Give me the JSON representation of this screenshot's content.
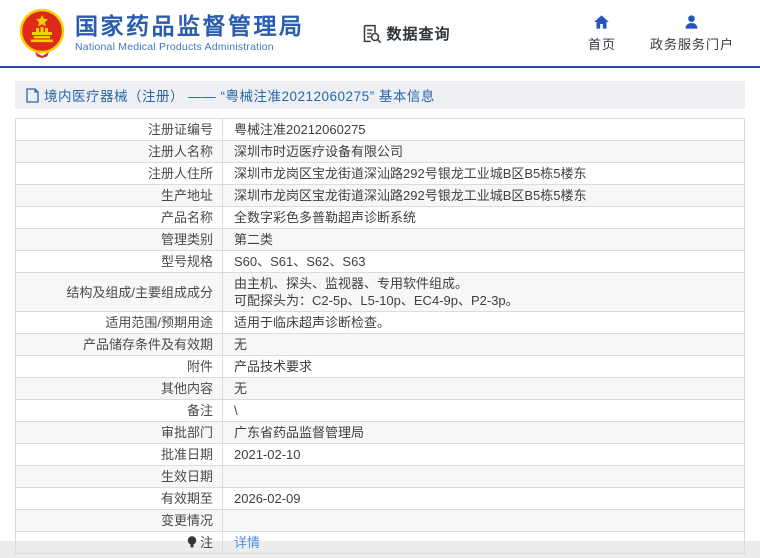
{
  "header": {
    "org_name_cn": "国家药品监督管理局",
    "org_name_en": "National Medical Products Administration",
    "data_query_label": "数据查询",
    "nav": [
      {
        "label": "首页",
        "icon": "home-icon"
      },
      {
        "label": "政务服务门户",
        "icon": "user-icon"
      }
    ]
  },
  "breadcrumb": {
    "text": "境内医疗器械（注册） —— “粤械注准20212060275” 基本信息"
  },
  "table": {
    "rows": [
      {
        "label": "注册证编号",
        "value": "粤械注准20212060275"
      },
      {
        "label": "注册人名称",
        "value": "深圳市时迈医疗设备有限公司"
      },
      {
        "label": "注册人住所",
        "value": "深圳市龙岗区宝龙街道深汕路292号银龙工业城B区B5栋5楼东"
      },
      {
        "label": "生产地址",
        "value": "深圳市龙岗区宝龙街道深汕路292号银龙工业城B区B5栋5楼东"
      },
      {
        "label": "产品名称",
        "value": "全数字彩色多普勒超声诊断系统"
      },
      {
        "label": "管理类别",
        "value": "第二类"
      },
      {
        "label": "型号规格",
        "value": "S60、S61、S62、S63"
      },
      {
        "label": "结构及组成/主要组成成分",
        "value": "由主机、探头、监视器、专用软件组成。\n可配探头为：C2-5p、L5-10p、EC4-9p、P2-3p。"
      },
      {
        "label": "适用范围/预期用途",
        "value": "适用于临床超声诊断检查。"
      },
      {
        "label": "产品储存条件及有效期",
        "value": "无"
      },
      {
        "label": "附件",
        "value": "产品技术要求"
      },
      {
        "label": "其他内容",
        "value": "无"
      },
      {
        "label": "备注",
        "value": "\\"
      },
      {
        "label": "审批部门",
        "value": "广东省药品监督管理局"
      },
      {
        "label": "批准日期",
        "value": "2021-02-10"
      },
      {
        "label": "生效日期",
        "value": ""
      },
      {
        "label": "有效期至",
        "value": "2026-02-09"
      },
      {
        "label": "变更情况",
        "value": ""
      },
      {
        "label": "注",
        "value": "详情",
        "link": true,
        "label_icon": "bulb"
      }
    ]
  },
  "colors": {
    "accent_blue": "#2a5db0",
    "header_rule": "#2b4a9e",
    "crumb_bg": "#edeff2",
    "crumb_text": "#2965ab",
    "link": "#4f8fdd",
    "emblem_red": "#de2a18",
    "emblem_gold": "#f8d000",
    "alt_row": "#f7f7f7"
  }
}
